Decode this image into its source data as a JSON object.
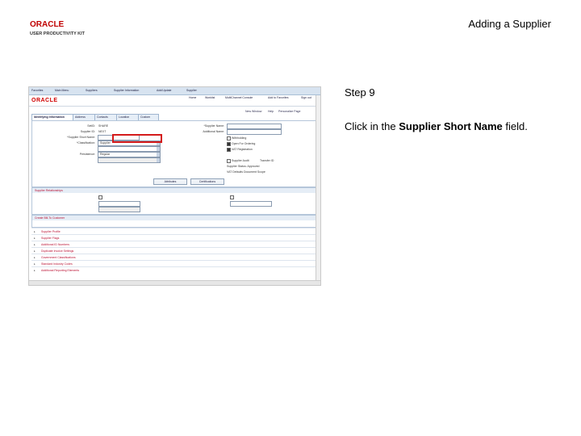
{
  "slide": {
    "title": "Adding a Supplier",
    "logo_line1": "ORACLE",
    "logo_line2": "USER PRODUCTIVITY KIT",
    "step": "Step 9",
    "instruction_prefix": "Click in the ",
    "instruction_bold": "Supplier Short Name",
    "instruction_suffix": " field."
  },
  "screenshot": {
    "nav": [
      "Favorites",
      "Main Menu",
      "Suppliers",
      "Supplier Information",
      "Add/Update",
      "Supplier"
    ],
    "brand": "ORACLE",
    "top_links": [
      "Home",
      "Worklist",
      "MultiChannel Console",
      "Add to Favorites",
      "Sign out"
    ],
    "page_links": [
      "New Window",
      "Help",
      "Personalize Page"
    ],
    "tabs": [
      "Identifying Information",
      "Address",
      "Contacts",
      "Location",
      "Custom"
    ],
    "fields_left": [
      {
        "label": "SetID:",
        "value": "SHARE"
      },
      {
        "label": "Supplier ID:",
        "value": "NEXT"
      },
      {
        "label": "*Supplier Short Name:",
        "value": ""
      },
      {
        "label": "*Classification:",
        "value": "Supplier"
      },
      {
        "label": "Persistence:",
        "value": "Regular"
      }
    ],
    "fields_right": [
      {
        "label": "*Supplier Name:",
        "value": ""
      },
      {
        "label": "Additional Name:",
        "value": ""
      }
    ],
    "checks": [
      "Withholding",
      "Open For Ordering",
      "VAT Registration",
      "Supplier Audit",
      "Transfer ID"
    ],
    "right_info": [
      "Supplier Status: Approved",
      "VAT Defaults Document Scope"
    ],
    "buttons": [
      "Attributes",
      "Certifications"
    ],
    "subsections": [
      "Supplier Relationships",
      "Create Bill-To Customer"
    ],
    "rows": [
      "Supplier Profile",
      "Supplier Flags",
      "Additional ID Numbers",
      "Duplicate Invoice Settings",
      "Government Classifications",
      "Standard Industry Codes",
      "Additional Reporting Elements"
    ]
  }
}
